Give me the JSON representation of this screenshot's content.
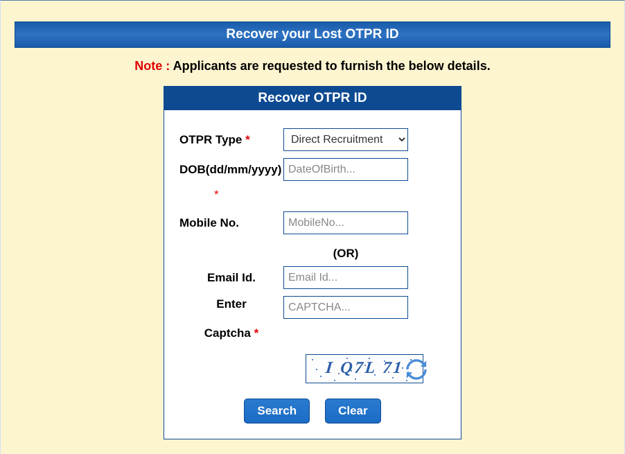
{
  "header": {
    "title": "Recover your Lost OTPR ID"
  },
  "note": {
    "label": "Note :",
    "text": " Applicants are requested to furnish the below details."
  },
  "form": {
    "card_title": "Recover OTPR ID",
    "otpr_type": {
      "label": "OTPR Type ",
      "selected": "Direct Recruitment"
    },
    "dob": {
      "label": "DOB(dd/mm/yyyy)",
      "placeholder": "DateOfBirth..."
    },
    "mobile": {
      "label": "Mobile No.",
      "placeholder": "MobileNo..."
    },
    "or_text": "(OR)",
    "email": {
      "label": "Email Id.",
      "placeholder": "Email Id..."
    },
    "captcha": {
      "label_line1": "Enter",
      "label_line2": "Captcha ",
      "placeholder": "CAPTCHA...",
      "image_text": "I Q7L 71"
    },
    "buttons": {
      "search": "Search",
      "clear": "Clear"
    }
  }
}
